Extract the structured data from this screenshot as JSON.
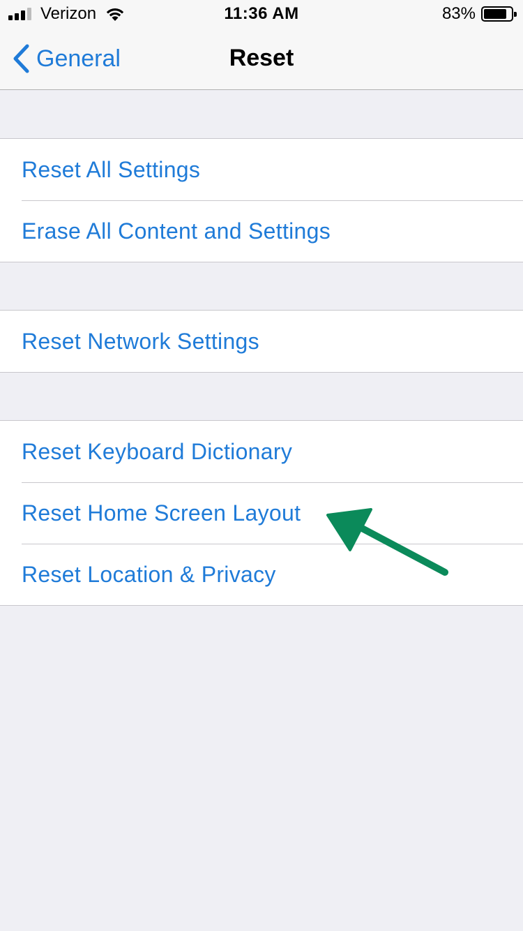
{
  "status_bar": {
    "carrier": "Verizon",
    "time": "11:36 AM",
    "battery_percent": "83%",
    "battery_level": 0.83,
    "signal_bars": 3,
    "signal_bars_total": 4
  },
  "nav": {
    "back_label": "General",
    "title": "Reset"
  },
  "groups": [
    {
      "items": [
        {
          "label": "Reset All Settings"
        },
        {
          "label": "Erase All Content and Settings"
        }
      ]
    },
    {
      "items": [
        {
          "label": "Reset Network Settings"
        }
      ]
    },
    {
      "items": [
        {
          "label": "Reset Keyboard Dictionary"
        },
        {
          "label": "Reset Home Screen Layout"
        },
        {
          "label": "Reset Location & Privacy"
        }
      ]
    }
  ],
  "colors": {
    "accent": "#1f7bd8",
    "background": "#efeff4",
    "arrow": "#0b8a5a"
  },
  "icons": {
    "back": "chevron-left-icon",
    "wifi": "wifi-icon",
    "battery": "battery-icon",
    "annotation": "arrow-annotation"
  }
}
